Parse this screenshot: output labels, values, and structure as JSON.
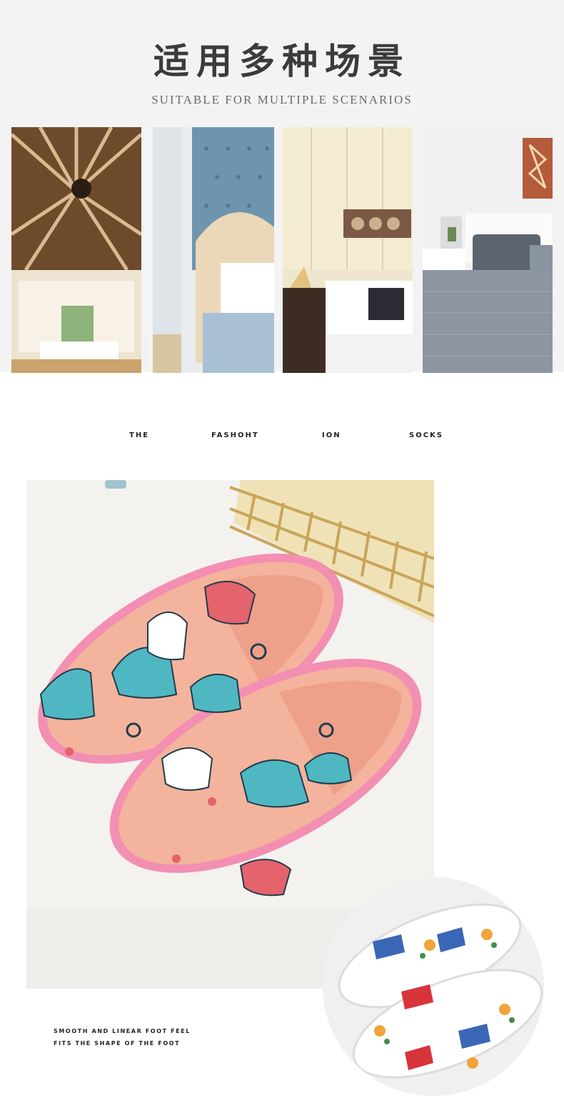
{
  "header": {
    "title_cn": "适用多种场景",
    "title_en": "SUITABLE FOR MULTIPLE SCENARIOS"
  },
  "scenes": [
    {
      "name": "resort-room-photo"
    },
    {
      "name": "tufted-headboard-bedroom-photo"
    },
    {
      "name": "hotel-room-photo"
    },
    {
      "name": "grey-bedroom-photo"
    }
  ],
  "tagline": {
    "words": [
      "THE",
      "FASHOHT",
      "ION",
      "SOCKS"
    ]
  },
  "features": {
    "line1": "SMOOTH AND LINEAR FOOT FEEL",
    "line2": "FITS THE SHAPE OF THE FOOT"
  },
  "colors": {
    "header_bg": "#f3f3f3",
    "slipper_pink": "#f4b39c",
    "slipper_trim": "#f28fb2",
    "pattern_teal": "#4fb7c2"
  }
}
